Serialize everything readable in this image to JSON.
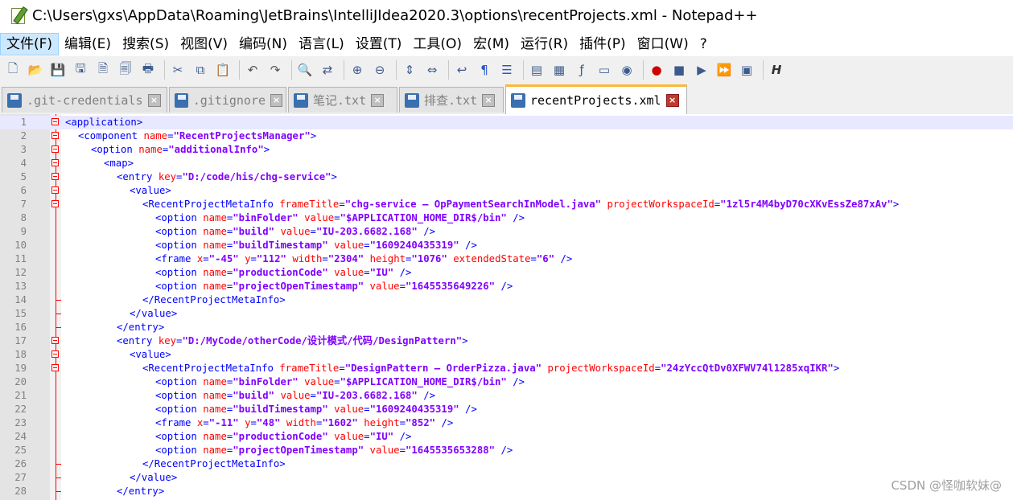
{
  "window": {
    "title": "C:\\Users\\gxs\\AppData\\Roaming\\JetBrains\\IntelliJIdea2020.3\\options\\recentProjects.xml - Notepad++"
  },
  "menu": [
    "文件(F)",
    "编辑(E)",
    "搜索(S)",
    "视图(V)",
    "编码(N)",
    "语言(L)",
    "设置(T)",
    "工具(O)",
    "宏(M)",
    "运行(R)",
    "插件(P)",
    "窗口(W)",
    "?"
  ],
  "toolbar_icons": [
    "new-file-icon",
    "open-file-icon",
    "save-icon",
    "save-all-icon",
    "close-icon",
    "close-all-icon",
    "print-icon",
    "|",
    "cut-icon",
    "copy-icon",
    "paste-icon",
    "|",
    "undo-icon",
    "redo-icon",
    "|",
    "find-icon",
    "replace-icon",
    "|",
    "zoom-in-icon",
    "zoom-out-icon",
    "|",
    "sync-vertical-icon",
    "sync-horizontal-icon",
    "|",
    "word-wrap-icon",
    "show-all-chars-icon",
    "indent-guide-icon",
    "|",
    "udl-icon",
    "doc-map-icon",
    "function-list-icon",
    "folder-as-workspace-icon",
    "monitor-icon",
    "|",
    "record-macro-icon",
    "stop-macro-icon",
    "play-macro-icon",
    "run-macro-multiple-icon",
    "save-macro-icon",
    "|",
    "h-icon"
  ],
  "tabs": [
    {
      "label": ".git-credentials",
      "active": false
    },
    {
      "label": ".gitignore",
      "active": false
    },
    {
      "label": "笔记.txt",
      "active": false
    },
    {
      "label": "排查.txt",
      "active": false
    },
    {
      "label": "recentProjects.xml",
      "active": true
    }
  ],
  "editor": {
    "lines": [
      {
        "n": "1",
        "fold": "open",
        "indent": 0,
        "tokens": [
          [
            "tg",
            "<application>"
          ]
        ]
      },
      {
        "n": "2",
        "fold": "open",
        "indent": 1,
        "tokens": [
          [
            "tg",
            "<component "
          ],
          [
            "at",
            "name"
          ],
          [
            "tg",
            "="
          ],
          [
            "vl",
            "\"RecentProjectsManager\""
          ],
          [
            "tg",
            ">"
          ]
        ]
      },
      {
        "n": "3",
        "fold": "open",
        "indent": 2,
        "tokens": [
          [
            "tg",
            "<option "
          ],
          [
            "at",
            "name"
          ],
          [
            "tg",
            "="
          ],
          [
            "vl",
            "\"additionalInfo\""
          ],
          [
            "tg",
            ">"
          ]
        ]
      },
      {
        "n": "4",
        "fold": "open",
        "indent": 3,
        "tokens": [
          [
            "tg",
            "<map>"
          ]
        ]
      },
      {
        "n": "5",
        "fold": "open",
        "indent": 4,
        "tokens": [
          [
            "tg",
            "<entry "
          ],
          [
            "at",
            "key"
          ],
          [
            "tg",
            "="
          ],
          [
            "vl",
            "\"D:/code/his/chg-service\""
          ],
          [
            "tg",
            ">"
          ]
        ]
      },
      {
        "n": "6",
        "fold": "open",
        "indent": 5,
        "tokens": [
          [
            "tg",
            "<value>"
          ]
        ]
      },
      {
        "n": "7",
        "fold": "open",
        "indent": 6,
        "tokens": [
          [
            "tg",
            "<RecentProjectMetaInfo "
          ],
          [
            "at",
            "frameTitle"
          ],
          [
            "tg",
            "="
          ],
          [
            "vl",
            "\"chg-service – OpPaymentSearchInModel.java\""
          ],
          [
            "tg",
            " "
          ],
          [
            "at",
            "projectWorkspaceId"
          ],
          [
            "tg",
            "="
          ],
          [
            "vl",
            "\"1zl5r4M4byD70cXKvEssZe87xAv\""
          ],
          [
            "tg",
            ">"
          ]
        ]
      },
      {
        "n": "8",
        "fold": "",
        "indent": 7,
        "tokens": [
          [
            "tg",
            "<option "
          ],
          [
            "at",
            "name"
          ],
          [
            "tg",
            "="
          ],
          [
            "vl",
            "\"binFolder\""
          ],
          [
            "tg",
            " "
          ],
          [
            "at",
            "value"
          ],
          [
            "tg",
            "="
          ],
          [
            "vl",
            "\"$APPLICATION_HOME_DIR$/bin\""
          ],
          [
            "tg",
            " />"
          ]
        ]
      },
      {
        "n": "9",
        "fold": "",
        "indent": 7,
        "tokens": [
          [
            "tg",
            "<option "
          ],
          [
            "at",
            "name"
          ],
          [
            "tg",
            "="
          ],
          [
            "vl",
            "\"build\""
          ],
          [
            "tg",
            " "
          ],
          [
            "at",
            "value"
          ],
          [
            "tg",
            "="
          ],
          [
            "vl",
            "\"IU-203.6682.168\""
          ],
          [
            "tg",
            " />"
          ]
        ]
      },
      {
        "n": "10",
        "fold": "",
        "indent": 7,
        "tokens": [
          [
            "tg",
            "<option "
          ],
          [
            "at",
            "name"
          ],
          [
            "tg",
            "="
          ],
          [
            "vl",
            "\"buildTimestamp\""
          ],
          [
            "tg",
            " "
          ],
          [
            "at",
            "value"
          ],
          [
            "tg",
            "="
          ],
          [
            "vl",
            "\"1609240435319\""
          ],
          [
            "tg",
            " />"
          ]
        ]
      },
      {
        "n": "11",
        "fold": "",
        "indent": 7,
        "tokens": [
          [
            "tg",
            "<frame "
          ],
          [
            "at",
            "x"
          ],
          [
            "tg",
            "="
          ],
          [
            "vl",
            "\"-45\""
          ],
          [
            "tg",
            " "
          ],
          [
            "at",
            "y"
          ],
          [
            "tg",
            "="
          ],
          [
            "vl",
            "\"112\""
          ],
          [
            "tg",
            " "
          ],
          [
            "at",
            "width"
          ],
          [
            "tg",
            "="
          ],
          [
            "vl",
            "\"2304\""
          ],
          [
            "tg",
            " "
          ],
          [
            "at",
            "height"
          ],
          [
            "tg",
            "="
          ],
          [
            "vl",
            "\"1076\""
          ],
          [
            "tg",
            " "
          ],
          [
            "at",
            "extendedState"
          ],
          [
            "tg",
            "="
          ],
          [
            "vl",
            "\"6\""
          ],
          [
            "tg",
            " />"
          ]
        ]
      },
      {
        "n": "12",
        "fold": "",
        "indent": 7,
        "tokens": [
          [
            "tg",
            "<option "
          ],
          [
            "at",
            "name"
          ],
          [
            "tg",
            "="
          ],
          [
            "vl",
            "\"productionCode\""
          ],
          [
            "tg",
            " "
          ],
          [
            "at",
            "value"
          ],
          [
            "tg",
            "="
          ],
          [
            "vl",
            "\"IU\""
          ],
          [
            "tg",
            " />"
          ]
        ]
      },
      {
        "n": "13",
        "fold": "",
        "indent": 7,
        "tokens": [
          [
            "tg",
            "<option "
          ],
          [
            "at",
            "name"
          ],
          [
            "tg",
            "="
          ],
          [
            "vl",
            "\"projectOpenTimestamp\""
          ],
          [
            "tg",
            " "
          ],
          [
            "at",
            "value"
          ],
          [
            "tg",
            "="
          ],
          [
            "vl",
            "\"1645535649226\""
          ],
          [
            "tg",
            " />"
          ]
        ]
      },
      {
        "n": "14",
        "fold": "end",
        "indent": 6,
        "tokens": [
          [
            "tg",
            "</RecentProjectMetaInfo>"
          ]
        ]
      },
      {
        "n": "15",
        "fold": "end",
        "indent": 5,
        "tokens": [
          [
            "tg",
            "</value>"
          ]
        ]
      },
      {
        "n": "16",
        "fold": "end",
        "indent": 4,
        "tokens": [
          [
            "tg",
            "</entry>"
          ]
        ]
      },
      {
        "n": "17",
        "fold": "open",
        "indent": 4,
        "tokens": [
          [
            "tg",
            "<entry "
          ],
          [
            "at",
            "key"
          ],
          [
            "tg",
            "="
          ],
          [
            "vl",
            "\"D:/MyCode/otherCode/设计模式/代码/DesignPattern\""
          ],
          [
            "tg",
            ">"
          ]
        ]
      },
      {
        "n": "18",
        "fold": "open",
        "indent": 5,
        "tokens": [
          [
            "tg",
            "<value>"
          ]
        ]
      },
      {
        "n": "19",
        "fold": "open",
        "indent": 6,
        "tokens": [
          [
            "tg",
            "<RecentProjectMetaInfo "
          ],
          [
            "at",
            "frameTitle"
          ],
          [
            "tg",
            "="
          ],
          [
            "vl",
            "\"DesignPattern – OrderPizza.java\""
          ],
          [
            "tg",
            " "
          ],
          [
            "at",
            "projectWorkspaceId"
          ],
          [
            "tg",
            "="
          ],
          [
            "vl",
            "\"24zYccQtDv0XFWV74l1285xqIKR\""
          ],
          [
            "tg",
            ">"
          ]
        ]
      },
      {
        "n": "20",
        "fold": "",
        "indent": 7,
        "tokens": [
          [
            "tg",
            "<option "
          ],
          [
            "at",
            "name"
          ],
          [
            "tg",
            "="
          ],
          [
            "vl",
            "\"binFolder\""
          ],
          [
            "tg",
            " "
          ],
          [
            "at",
            "value"
          ],
          [
            "tg",
            "="
          ],
          [
            "vl",
            "\"$APPLICATION_HOME_DIR$/bin\""
          ],
          [
            "tg",
            " />"
          ]
        ]
      },
      {
        "n": "21",
        "fold": "",
        "indent": 7,
        "tokens": [
          [
            "tg",
            "<option "
          ],
          [
            "at",
            "name"
          ],
          [
            "tg",
            "="
          ],
          [
            "vl",
            "\"build\""
          ],
          [
            "tg",
            " "
          ],
          [
            "at",
            "value"
          ],
          [
            "tg",
            "="
          ],
          [
            "vl",
            "\"IU-203.6682.168\""
          ],
          [
            "tg",
            " />"
          ]
        ]
      },
      {
        "n": "22",
        "fold": "",
        "indent": 7,
        "tokens": [
          [
            "tg",
            "<option "
          ],
          [
            "at",
            "name"
          ],
          [
            "tg",
            "="
          ],
          [
            "vl",
            "\"buildTimestamp\""
          ],
          [
            "tg",
            " "
          ],
          [
            "at",
            "value"
          ],
          [
            "tg",
            "="
          ],
          [
            "vl",
            "\"1609240435319\""
          ],
          [
            "tg",
            " />"
          ]
        ]
      },
      {
        "n": "23",
        "fold": "",
        "indent": 7,
        "tokens": [
          [
            "tg",
            "<frame "
          ],
          [
            "at",
            "x"
          ],
          [
            "tg",
            "="
          ],
          [
            "vl",
            "\"-11\""
          ],
          [
            "tg",
            " "
          ],
          [
            "at",
            "y"
          ],
          [
            "tg",
            "="
          ],
          [
            "vl",
            "\"48\""
          ],
          [
            "tg",
            " "
          ],
          [
            "at",
            "width"
          ],
          [
            "tg",
            "="
          ],
          [
            "vl",
            "\"1602\""
          ],
          [
            "tg",
            " "
          ],
          [
            "at",
            "height"
          ],
          [
            "tg",
            "="
          ],
          [
            "vl",
            "\"852\""
          ],
          [
            "tg",
            " />"
          ]
        ]
      },
      {
        "n": "24",
        "fold": "",
        "indent": 7,
        "tokens": [
          [
            "tg",
            "<option "
          ],
          [
            "at",
            "name"
          ],
          [
            "tg",
            "="
          ],
          [
            "vl",
            "\"productionCode\""
          ],
          [
            "tg",
            " "
          ],
          [
            "at",
            "value"
          ],
          [
            "tg",
            "="
          ],
          [
            "vl",
            "\"IU\""
          ],
          [
            "tg",
            " />"
          ]
        ]
      },
      {
        "n": "25",
        "fold": "",
        "indent": 7,
        "tokens": [
          [
            "tg",
            "<option "
          ],
          [
            "at",
            "name"
          ],
          [
            "tg",
            "="
          ],
          [
            "vl",
            "\"projectOpenTimestamp\""
          ],
          [
            "tg",
            " "
          ],
          [
            "at",
            "value"
          ],
          [
            "tg",
            "="
          ],
          [
            "vl",
            "\"1645535653288\""
          ],
          [
            "tg",
            " />"
          ]
        ]
      },
      {
        "n": "26",
        "fold": "end",
        "indent": 6,
        "tokens": [
          [
            "tg",
            "</RecentProjectMetaInfo>"
          ]
        ]
      },
      {
        "n": "27",
        "fold": "end",
        "indent": 5,
        "tokens": [
          [
            "tg",
            "</value>"
          ]
        ]
      },
      {
        "n": "28",
        "fold": "end",
        "indent": 4,
        "tokens": [
          [
            "tg",
            "</entry>"
          ]
        ]
      }
    ],
    "current_line": "1"
  },
  "watermark": "CSDN @怪咖软妹@",
  "colors": {
    "tag": "#0000ff",
    "attr": "#ff0000",
    "value": "#8000ff",
    "fold": "#ff0000",
    "active_tab_accent": "#fab83b"
  }
}
